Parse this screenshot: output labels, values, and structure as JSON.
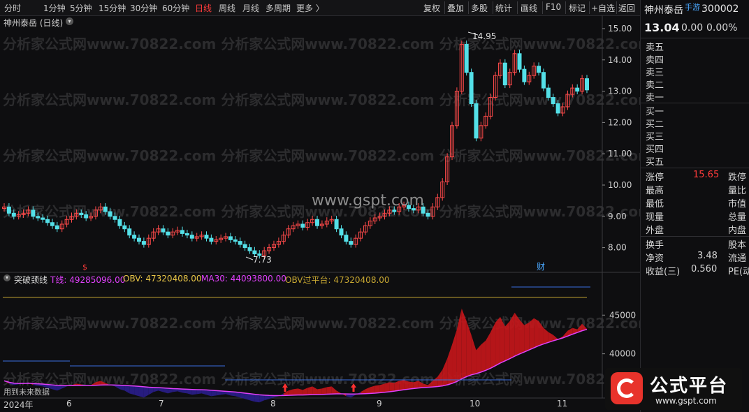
{
  "toolbar": {
    "periods": [
      "分时",
      "1分钟",
      "5分钟",
      "15分钟",
      "30分钟",
      "60分钟",
      "日线",
      "周线",
      "月线",
      "多周期",
      "更多 〉"
    ],
    "active_period": "日线",
    "tools": [
      "复权",
      "叠加",
      "多股",
      "统计",
      "画线",
      "F10",
      "标记",
      "+自选",
      "返回"
    ]
  },
  "main_chart": {
    "title": "神州泰岳 (日线)",
    "price_ticks": [
      "15.00",
      "14.00",
      "13.00",
      "12.00",
      "11.00",
      "10.00",
      "9.00",
      "8.00"
    ],
    "high_label": "14.95",
    "low_label": "7.73",
    "marker_financial": "财",
    "marker_dividend": "$",
    "watermark_center": "www.gspt.com",
    "watermark_rows": "分析家公式网www.70822.com  分析家公式网www.70822.com  分析家公式网www.70822.com"
  },
  "indicator": {
    "name": "突破颈线",
    "t_line_label": "T线: 49285096.00",
    "obv_label": "OBV: 47320408.00",
    "ma30_label": "MA30: 44093800.00",
    "obv_platform_label": "OBV过平台: 47320408.00",
    "y_ticks": [
      "45000",
      "40000"
    ],
    "future_data_note": "用到未来数据",
    "colors": {
      "t_line": "#e040fb",
      "obv": "#e8c547",
      "ma30": "#e040fb",
      "platform": "#c8a832"
    }
  },
  "x_axis": {
    "labels": [
      "2024年",
      "6",
      "7",
      "8",
      "9",
      "10",
      "11"
    ]
  },
  "quote_panel": {
    "stock_name": "神州泰岳",
    "tag": "手游",
    "code": "300002",
    "price": "13.04",
    "change": "0.00",
    "change_pct": "0.00%",
    "asks": [
      "卖五",
      "卖四",
      "卖三",
      "卖二",
      "卖一"
    ],
    "bids": [
      "买一",
      "买二",
      "买三",
      "买四",
      "买五"
    ],
    "limit_up_label": "涨停",
    "limit_up_value": "15.65",
    "limit_down_label": "跌停",
    "rows": [
      {
        "label": "最高",
        "right": "量比"
      },
      {
        "label": "最低",
        "right": "市值"
      },
      {
        "label": "现量",
        "right": "总量"
      },
      {
        "label": "外盘",
        "right": "内盘"
      }
    ],
    "turnover_label": "换手",
    "turnover_right": "股本",
    "net_assets_label": "净资",
    "net_assets_value": "3.48",
    "net_assets_right": "流通",
    "eps_label": "收益(三)",
    "eps_value": "0.560",
    "eps_right": "PE(动)"
  },
  "logo": {
    "text": "公式平台",
    "url": "www.gspt.com"
  },
  "chart_data": {
    "type": "candlestick",
    "price_range": [
      7.5,
      15.2
    ],
    "closes": [
      9.3,
      9.1,
      9.0,
      9.05,
      9.1,
      9.2,
      9.0,
      8.95,
      8.9,
      8.8,
      8.7,
      8.6,
      8.75,
      8.9,
      9.0,
      9.1,
      9.05,
      8.95,
      9.0,
      9.2,
      9.3,
      9.15,
      9.0,
      8.9,
      8.7,
      8.6,
      8.4,
      8.3,
      8.2,
      8.1,
      8.3,
      8.5,
      8.6,
      8.5,
      8.4,
      8.5,
      8.55,
      8.45,
      8.4,
      8.3,
      8.35,
      8.4,
      8.3,
      8.2,
      8.25,
      8.3,
      8.35,
      8.25,
      8.2,
      8.1,
      8.0,
      7.9,
      7.8,
      7.75,
      7.9,
      8.0,
      8.1,
      8.2,
      8.4,
      8.6,
      8.7,
      8.75,
      8.65,
      8.8,
      8.9,
      8.7,
      8.75,
      8.85,
      8.9,
      8.6,
      8.4,
      8.2,
      8.1,
      8.3,
      8.5,
      8.7,
      8.85,
      8.95,
      9.0,
      9.1,
      9.2,
      9.15,
      9.3,
      9.35,
      9.25,
      9.2,
      9.3,
      9.1,
      9.0,
      9.3,
      9.6,
      10.1,
      10.9,
      11.9,
      13.0,
      14.5,
      13.6,
      12.6,
      11.5,
      11.9,
      12.2,
      12.8,
      13.5,
      13.9,
      13.2,
      13.6,
      14.2,
      13.7,
      13.3,
      13.5,
      13.8,
      13.6,
      13.1,
      12.8,
      12.6,
      12.3,
      12.5,
      12.9,
      13.1,
      13.0,
      13.4,
      13.04
    ],
    "obv_range": [
      35000000,
      49000000
    ],
    "platform_value": 47320408
  }
}
